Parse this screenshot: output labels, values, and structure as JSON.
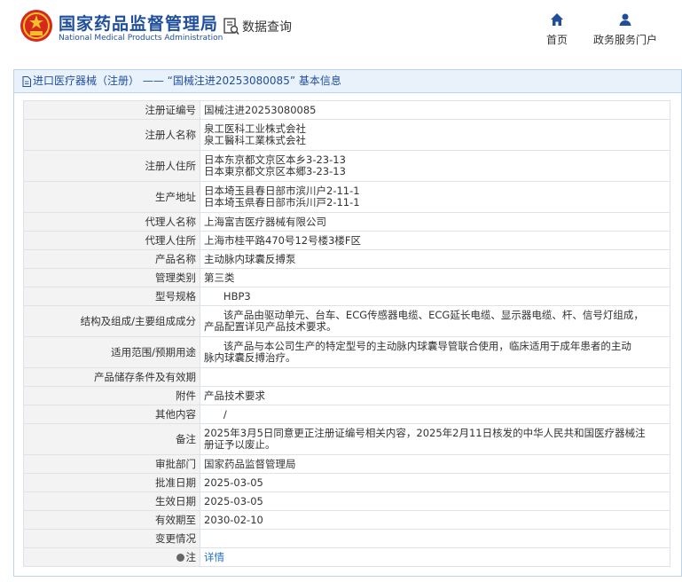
{
  "header": {
    "logo_cn": "国家药品监督管理局",
    "logo_en": "National Medical Products Administration",
    "page_title": "数据查询",
    "nav": {
      "home_label": "首页",
      "gov_service_label": "政务服务门户"
    },
    "colors": {
      "brand": "#1f4e9a",
      "emblem_red": "#d7281e",
      "emblem_gold": "#f3c02a"
    }
  },
  "panel": {
    "title": "进口医疗器械（注册） —— “国械注进20253080085” 基本信息"
  },
  "rows": [
    {
      "label": "注册证编号",
      "lines": [
        "国械注进20253080085"
      ]
    },
    {
      "label": "注册人名称",
      "lines": [
        "泉工医科工业株式会社",
        "泉工醫科工業株式会社"
      ]
    },
    {
      "label": "注册人住所",
      "lines": [
        "日本东京都文京区本乡3-23-13",
        "日本東京都文京区本郷3-23-13"
      ]
    },
    {
      "label": "生产地址",
      "lines": [
        "日本埼玉县春日部市滨川户2-11-1",
        "日本埼玉県春日部市浜川戸2-11-1"
      ]
    },
    {
      "label": "代理人名称",
      "lines": [
        "上海富吉医疗器械有限公司"
      ]
    },
    {
      "label": "代理人住所",
      "lines": [
        "上海市桂平路470号12号楼3楼F区"
      ]
    },
    {
      "label": "产品名称",
      "lines": [
        "主动脉内球囊反搏泵"
      ]
    },
    {
      "label": "管理类别",
      "lines": [
        "第三类"
      ]
    },
    {
      "label": "型号规格",
      "lines": [
        "      HBP3"
      ]
    },
    {
      "label": "结构及组成/主要组成成分",
      "lines": [
        "      该产品由驱动单元、台车、ECG传感器电缆、ECG延长电缆、显示器电缆、杆、信号灯组成，",
        "产品配置详见产品技术要求。"
      ]
    },
    {
      "label": "适用范围/预期用途",
      "lines": [
        "      该产品与本公司生产的特定型号的主动脉内球囊导管联合使用，临床适用于成年患者的主动",
        "脉内球囊反搏治疗。"
      ]
    },
    {
      "label": "产品储存条件及有效期",
      "lines": [
        ""
      ]
    },
    {
      "label": "附件",
      "lines": [
        "产品技术要求"
      ]
    },
    {
      "label": "其他内容",
      "lines": [
        "      /"
      ]
    },
    {
      "label": "备注",
      "lines": [
        "2025年3月5日同意更正注册证编号相关内容，2025年2月11日核发的中华人民共和国医疗器械注",
        "册证予以废止。"
      ]
    },
    {
      "label": "审批部门",
      "lines": [
        "国家药品监督管理局"
      ]
    },
    {
      "label": "批准日期",
      "lines": [
        "2025-03-05"
      ]
    },
    {
      "label": "生效日期",
      "lines": [
        "2025-03-05"
      ]
    },
    {
      "label": "有效期至",
      "lines": [
        "2030-02-10"
      ]
    },
    {
      "label": "变更情况",
      "lines": [
        ""
      ]
    }
  ],
  "note_row": {
    "label": "注",
    "link": "详情"
  }
}
